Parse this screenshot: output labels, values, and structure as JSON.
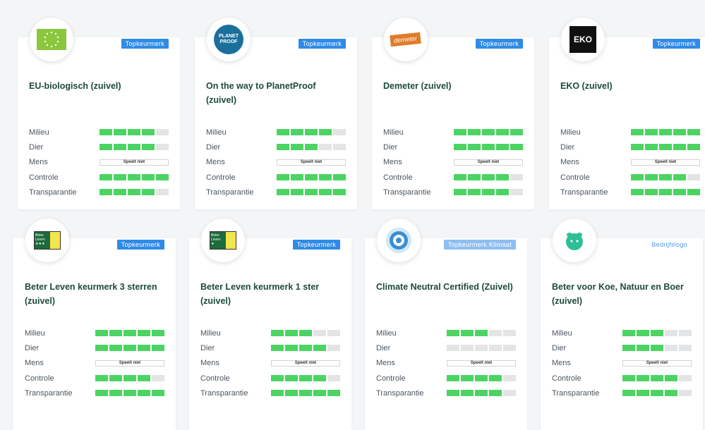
{
  "colors": {
    "bar_on": "#4bd462",
    "bar_off": "#e2e4e6",
    "badge_blue": "#2f8be6",
    "title_green": "#1d4a3a"
  },
  "criteria": [
    "Milieu",
    "Dier",
    "Mens",
    "Controle",
    "Transparantie"
  ],
  "not_applicable_text": "Speelt niet",
  "cards": [
    {
      "title": "EU-biologisch (zuivel)",
      "badge": "Topkeurmerk",
      "badge_style": "solid",
      "logo_icon": "eu-organic-leaf-logo",
      "scores": [
        4,
        4,
        null,
        5,
        4
      ]
    },
    {
      "title": "On the way to PlanetProof (zuivel)",
      "badge": "Topkeurmerk",
      "badge_style": "solid",
      "logo_icon": "planetproof-logo",
      "logo_text": "PLANET PROOF",
      "scores": [
        4,
        3,
        null,
        5,
        5
      ]
    },
    {
      "title": "Demeter (zuivel)",
      "badge": "Topkeurmerk",
      "badge_style": "solid",
      "logo_icon": "demeter-logo",
      "logo_text": "demeter",
      "scores": [
        5,
        5,
        null,
        4,
        4
      ]
    },
    {
      "title": "EKO (zuivel)",
      "badge": "Topkeurmerk",
      "badge_style": "solid",
      "logo_icon": "eko-logo",
      "logo_text": "EKO",
      "scores": [
        5,
        5,
        null,
        4,
        5
      ]
    },
    {
      "title": "Beter Leven keurmerk 3 sterren (zuivel)",
      "badge": "Topkeurmerk",
      "badge_style": "solid",
      "logo_icon": "beter-leven-logo",
      "logo_text": "Beter Leven",
      "stars": "★★★",
      "scores": [
        5,
        5,
        null,
        4,
        5
      ]
    },
    {
      "title": "Beter Leven keurmerk 1 ster (zuivel)",
      "badge": "Topkeurmerk",
      "badge_style": "solid",
      "logo_icon": "beter-leven-logo",
      "logo_text": "Beter Leven",
      "stars": "★",
      "scores": [
        3,
        4,
        null,
        4,
        5
      ]
    },
    {
      "title": "Climate Neutral Certified (Zuivel)",
      "badge": "Topkeurmerk Klimaat",
      "badge_style": "light",
      "logo_icon": "climate-neutral-logo",
      "scores": [
        3,
        0,
        null,
        4,
        4
      ]
    },
    {
      "title": "Beter voor Koe, Natuur en Boer (zuivel)",
      "badge": "Bedrijfslogo",
      "badge_style": "outline",
      "logo_icon": "beter-voor-koe-logo",
      "scores": [
        3,
        3,
        null,
        4,
        4
      ]
    }
  ]
}
